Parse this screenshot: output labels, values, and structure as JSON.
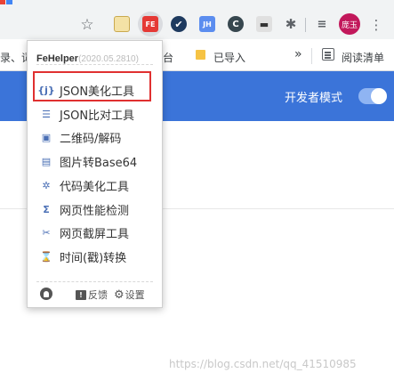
{
  "toolbar": {
    "star_icon": "star-icon",
    "avatar_text": "庞玉"
  },
  "bookmarks": {
    "left_text": "录、词",
    "tai_text": "台",
    "import_label": "已导入",
    "more_label": "»",
    "reading_list_label": "阅读清单"
  },
  "header": {
    "dev_mode_label": "开发者模式",
    "dev_mode_on": true,
    "color": "#3b74d9"
  },
  "popup": {
    "app_name": "FeHelper",
    "version": "(2020.05.2810)",
    "items": [
      {
        "label": "JSON美化工具",
        "icon": "{j}"
      },
      {
        "label": "JSON比对工具",
        "icon": "☰"
      },
      {
        "label": "二维码/解码",
        "icon": "▣"
      },
      {
        "label": "图片转Base64",
        "icon": "▤"
      },
      {
        "label": "代码美化工具",
        "icon": "✲"
      },
      {
        "label": "网页性能检测",
        "icon": "Σ"
      },
      {
        "label": "网页截屏工具",
        "icon": "✂"
      },
      {
        "label": "时间(戳)转换",
        "icon": "⌛"
      }
    ],
    "footer": {
      "feedback_label": "反馈",
      "settings_label": "设置"
    },
    "highlight_color": "#e03030"
  },
  "watermark": "https://blog.csdn.net/qq_41510985"
}
